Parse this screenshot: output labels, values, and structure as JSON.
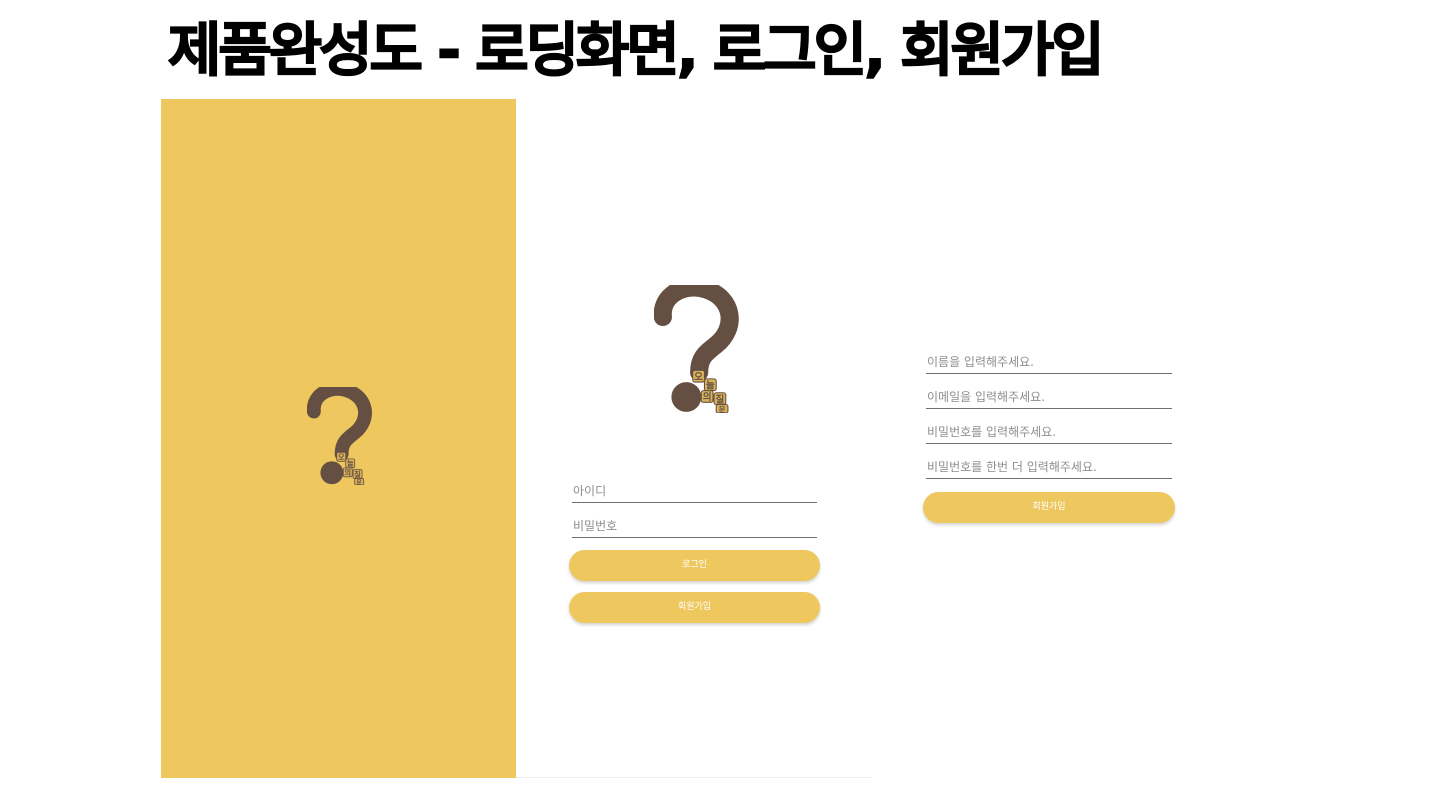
{
  "slide": {
    "title": "제품완성도 - 로딩화면, 로그인, 회원가입"
  },
  "colors": {
    "brand_yellow": "#EEC85F",
    "logo_brown": "#654F42",
    "field_underline": "#6F6F6F",
    "placeholder_gray": "#8E8E8E"
  },
  "logo": {
    "icon": "question-mark-icon",
    "caption_glyphs": [
      "오",
      "늘",
      "의",
      "질",
      "문"
    ]
  },
  "login": {
    "id_placeholder": "아이디",
    "password_placeholder": "비밀번호",
    "login_button": "로그인",
    "signup_button": "회원가입"
  },
  "signup": {
    "name_placeholder": "이름을 입력해주세요.",
    "email_placeholder": "이메일을 입력해주세요.",
    "password_placeholder": "비밀번호를 입력해주세요.",
    "password_confirm_placeholder": "비밀번호를 한번 더 입력해주세요.",
    "signup_button": "회원가입"
  }
}
